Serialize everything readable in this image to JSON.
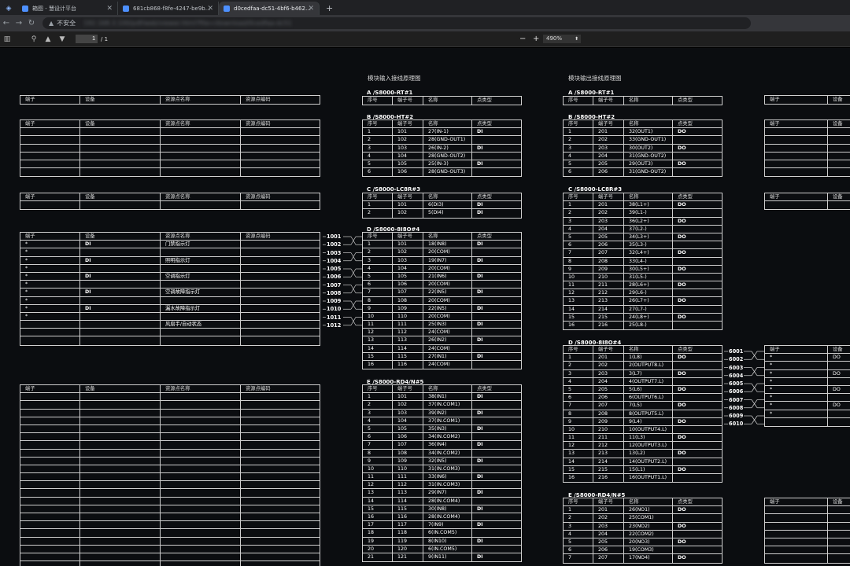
{
  "browser": {
    "tabs": [
      {
        "title": "箱图 - 慧设计平台",
        "active": false
      },
      {
        "title": "681cb868-f8fe-4247-be9b-6...",
        "active": false
      },
      {
        "title": "d0cedfaa-dc51-4bf6-b462-a...",
        "active": true
      }
    ],
    "insecure_label": "不安全",
    "url": "192.168.3.100/pdf/web/viewer.html?file=/download/0cedfaa-dc51"
  },
  "pdf": {
    "page": "1",
    "total": "/ 1",
    "zoom": "490%"
  },
  "headings": {
    "input": "模块输入接线原理图",
    "output": "模块输出接线原理图"
  },
  "left_header": [
    "端子",
    "设备",
    "资源点名称",
    "资源点编码"
  ],
  "left_block4": [
    [
      "*",
      "DI",
      "门禁指示灯",
      ""
    ],
    [
      "*",
      "",
      "",
      ""
    ],
    [
      "*",
      "DI",
      "照明指示灯",
      ""
    ],
    [
      "*",
      "",
      "",
      ""
    ],
    [
      "*",
      "DI",
      "空调指示灯",
      ""
    ],
    [
      "*",
      "",
      "",
      ""
    ],
    [
      "*",
      "DI",
      "空调故障指示灯",
      ""
    ],
    [
      "*",
      "",
      "",
      ""
    ],
    [
      "*",
      "DI",
      "漏水故障指示灯",
      ""
    ],
    [
      "*",
      "",
      "",
      ""
    ],
    [
      "",
      "",
      "风扇手/自动状态",
      ""
    ],
    [
      "",
      "",
      "",
      ""
    ],
    [
      "",
      "",
      "",
      ""
    ]
  ],
  "in_header": [
    "序号",
    "端子号",
    "名称",
    "点类型"
  ],
  "out_header": [
    "序号",
    "端子号",
    "名称",
    "点类型"
  ],
  "in": {
    "A": {
      "title": "A /S8000-RT#1"
    },
    "B": {
      "title": "B /S8000-HT#2",
      "rows": [
        [
          "1",
          "101",
          "27(IN-1)",
          "DI"
        ],
        [
          "2",
          "102",
          "28(GND-OUT1)",
          ""
        ],
        [
          "3",
          "103",
          "26(IN-2)",
          "DI"
        ],
        [
          "4",
          "104",
          "28(GND-OUT2)",
          ""
        ],
        [
          "5",
          "105",
          "25(IN-3)",
          "DI"
        ],
        [
          "6",
          "106",
          "28(GND-OUT3)",
          ""
        ]
      ]
    },
    "C": {
      "title": "C /S8000-LC8R#3",
      "rows": [
        [
          "1",
          "101",
          "6(DI3)",
          "DI"
        ],
        [
          "2",
          "102",
          "5(DI4)",
          "DI"
        ]
      ]
    },
    "D": {
      "title": "D /S8000-8I8O#4",
      "rows": [
        [
          "1",
          "101",
          "18(IN8)",
          "DI"
        ],
        [
          "2",
          "102",
          "20(COM)",
          ""
        ],
        [
          "3",
          "103",
          "19(IN7)",
          "DI"
        ],
        [
          "4",
          "104",
          "20(COM)",
          ""
        ],
        [
          "5",
          "105",
          "21(IN6)",
          "DI"
        ],
        [
          "6",
          "106",
          "20(COM)",
          ""
        ],
        [
          "7",
          "107",
          "22(IN5)",
          "DI"
        ],
        [
          "8",
          "108",
          "20(COM)",
          ""
        ],
        [
          "9",
          "109",
          "22(IN5)",
          "DI"
        ],
        [
          "10",
          "110",
          "20(COM)",
          ""
        ],
        [
          "11",
          "111",
          "25(IN3)",
          "DI"
        ],
        [
          "12",
          "112",
          "24(COM)",
          ""
        ],
        [
          "13",
          "113",
          "26(IN2)",
          "DI"
        ],
        [
          "14",
          "114",
          "24(COM)",
          ""
        ],
        [
          "15",
          "115",
          "27(IN1)",
          "DI"
        ],
        [
          "16",
          "116",
          "24(COM)",
          ""
        ]
      ]
    },
    "E": {
      "title": "E /S8000-RD4/N#5",
      "rows": [
        [
          "1",
          "101",
          "38(IN1)",
          "DI"
        ],
        [
          "2",
          "102",
          "37(IN.COM1)",
          ""
        ],
        [
          "3",
          "103",
          "39(IN2)",
          "DI"
        ],
        [
          "4",
          "104",
          "37(IN.COM1)",
          ""
        ],
        [
          "5",
          "105",
          "35(IN3)",
          "DI"
        ],
        [
          "6",
          "106",
          "34(IN.COM2)",
          ""
        ],
        [
          "7",
          "107",
          "36(IN4)",
          "DI"
        ],
        [
          "8",
          "108",
          "34(IN.COM2)",
          ""
        ],
        [
          "9",
          "109",
          "32(IN5)",
          "DI"
        ],
        [
          "10",
          "110",
          "31(IN.COM3)",
          ""
        ],
        [
          "11",
          "111",
          "33(IN6)",
          "DI"
        ],
        [
          "12",
          "112",
          "31(IN.COM3)",
          ""
        ],
        [
          "13",
          "113",
          "29(IN7)",
          "DI"
        ],
        [
          "14",
          "114",
          "28(IN.COM4)",
          ""
        ],
        [
          "15",
          "115",
          "30(IN8)",
          "DI"
        ],
        [
          "16",
          "116",
          "28(IN.COM4)",
          ""
        ],
        [
          "17",
          "117",
          "7(IN9)",
          "DI"
        ],
        [
          "18",
          "118",
          "6(IN.COM5)",
          ""
        ],
        [
          "19",
          "119",
          "8(IN10)",
          "DI"
        ],
        [
          "20",
          "120",
          "6(IN.COM5)",
          ""
        ],
        [
          "21",
          "121",
          "9(IN11)",
          "DI"
        ]
      ]
    }
  },
  "out": {
    "A": {
      "title": "A /S8000-RT#1"
    },
    "B": {
      "title": "B /S8000-HT#2",
      "rows": [
        [
          "1",
          "201",
          "32(OUT1)",
          "DO"
        ],
        [
          "2",
          "202",
          "33(GND-OUT1)",
          ""
        ],
        [
          "3",
          "203",
          "30(OUT2)",
          "DO"
        ],
        [
          "4",
          "204",
          "31(GND-OUT2)",
          ""
        ],
        [
          "5",
          "205",
          "29(OUT3)",
          "DO"
        ],
        [
          "6",
          "206",
          "31(GND-OUT2)",
          ""
        ]
      ]
    },
    "C": {
      "title": "C /S8000-LC8R#3",
      "rows": [
        [
          "1",
          "201",
          "38(L1+)",
          "DO"
        ],
        [
          "2",
          "202",
          "39(L1-)",
          ""
        ],
        [
          "3",
          "203",
          "36(L2+)",
          "DO"
        ],
        [
          "4",
          "204",
          "37(L2-)",
          ""
        ],
        [
          "5",
          "205",
          "34(L3+)",
          "DO"
        ],
        [
          "6",
          "206",
          "35(L3-)",
          ""
        ],
        [
          "7",
          "207",
          "32(L4+)",
          "DO"
        ],
        [
          "8",
          "208",
          "33(L4-)",
          ""
        ],
        [
          "9",
          "209",
          "30(L5+)",
          "DO"
        ],
        [
          "10",
          "210",
          "31(L5-)",
          ""
        ],
        [
          "11",
          "211",
          "28(L6+)",
          "DO"
        ],
        [
          "12",
          "212",
          "29(L6-)",
          ""
        ],
        [
          "13",
          "213",
          "26(L7+)",
          "DO"
        ],
        [
          "14",
          "214",
          "27(L7-)",
          ""
        ],
        [
          "15",
          "215",
          "24(L8+)",
          "DO"
        ],
        [
          "16",
          "216",
          "25(L8-)",
          ""
        ]
      ]
    },
    "D": {
      "title": "D /S8000-8I8O#4",
      "rows": [
        [
          "1",
          "201",
          "1(L8)",
          "DO"
        ],
        [
          "2",
          "202",
          "2(OUTPUT8.L)",
          ""
        ],
        [
          "3",
          "203",
          "3(L7)",
          "DO"
        ],
        [
          "4",
          "204",
          "4(OUTPUT7.L)",
          ""
        ],
        [
          "5",
          "205",
          "5(L6)",
          "DO"
        ],
        [
          "6",
          "206",
          "6(OUTPUT6.L)",
          ""
        ],
        [
          "7",
          "207",
          "7(L5)",
          "DO"
        ],
        [
          "8",
          "208",
          "8(OUTPUT5.L)",
          ""
        ],
        [
          "9",
          "209",
          "9(L4)",
          "DO"
        ],
        [
          "10",
          "210",
          "10(OUTPUT4.L)",
          ""
        ],
        [
          "11",
          "211",
          "11(L3)",
          "DO"
        ],
        [
          "12",
          "212",
          "12(OUTPUT3.L)",
          ""
        ],
        [
          "13",
          "213",
          "13(L2)",
          "DO"
        ],
        [
          "14",
          "214",
          "14(OUTPUT2.L)",
          ""
        ],
        [
          "15",
          "215",
          "15(L1)",
          "DO"
        ],
        [
          "16",
          "216",
          "16(OUTPUT1.L)",
          ""
        ]
      ]
    },
    "E": {
      "title": "E /S8000-RD4/N#5",
      "rows": [
        [
          "1",
          "201",
          "26(NO1)",
          "DO"
        ],
        [
          "2",
          "202",
          "25(COM1)",
          ""
        ],
        [
          "3",
          "203",
          "23(NO2)",
          "DO"
        ],
        [
          "4",
          "204",
          "22(COM2)",
          ""
        ],
        [
          "5",
          "205",
          "20(NO3)",
          "DO"
        ],
        [
          "6",
          "206",
          "19(COM3)",
          ""
        ],
        [
          "7",
          "207",
          "17(NO4)",
          "DO"
        ]
      ]
    }
  },
  "in_links": [
    "1001",
    "1002",
    "1003",
    "1004",
    "1005",
    "1006",
    "1007",
    "1008",
    "1009",
    "1010",
    "1011",
    "1012"
  ],
  "out_links": [
    "6001",
    "6002",
    "6003",
    "6004",
    "6005",
    "6006",
    "6007",
    "6008",
    "6009",
    "6010"
  ],
  "right_header": [
    "端子",
    "设备"
  ],
  "right_block_rows": [
    [
      "*",
      "DO"
    ],
    [
      "*",
      ""
    ],
    [
      "*",
      "DO"
    ],
    [
      "*",
      ""
    ],
    [
      "*",
      "DO"
    ],
    [
      "*",
      ""
    ],
    [
      "*",
      "DO"
    ],
    [
      "*",
      ""
    ],
    [
      "",
      ""
    ]
  ]
}
